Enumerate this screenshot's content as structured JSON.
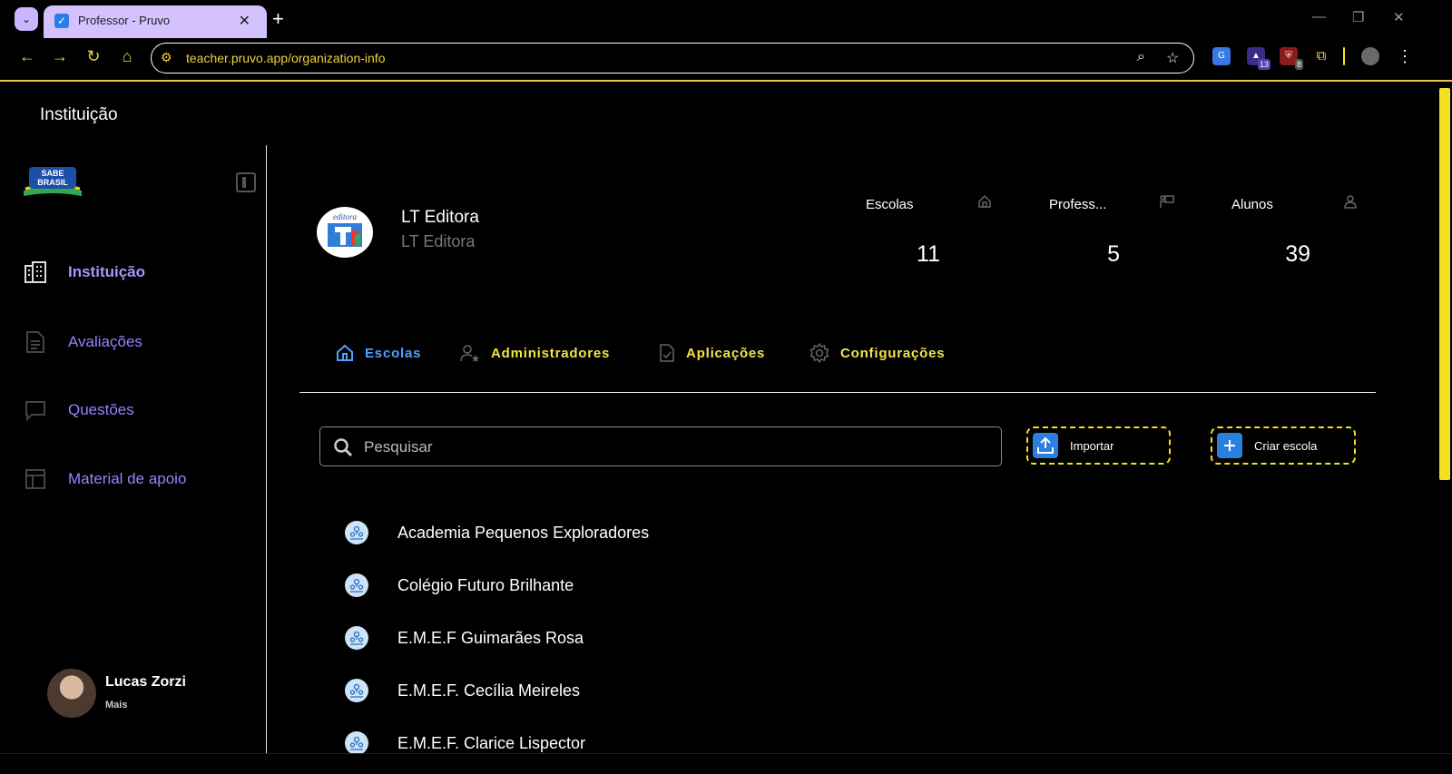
{
  "browser": {
    "tab_title": "Professor - Pruvo",
    "url": "teacher.pruvo.app/organization-info",
    "extensions": [
      {
        "name": "google-translate-icon",
        "badge": ""
      },
      {
        "name": "graduation-cap-extension-icon",
        "badge": "13"
      },
      {
        "name": "shield-extension-icon",
        "badge": "8"
      },
      {
        "name": "puzzle-icon",
        "badge": ""
      }
    ]
  },
  "page": {
    "header": "Instituição"
  },
  "sidebar": {
    "logo_text": "SABE BRASIL",
    "items": [
      {
        "label": "Instituição",
        "icon": "building-icon",
        "active": true
      },
      {
        "label": "Avaliações",
        "icon": "document-icon",
        "active": false
      },
      {
        "label": "Questões",
        "icon": "chat-icon",
        "active": false
      },
      {
        "label": "Material de apoio",
        "icon": "layout-icon",
        "active": false
      }
    ],
    "user": {
      "name": "Lucas Zorzi",
      "sub": "Mais"
    }
  },
  "org": {
    "name": "LT Editora",
    "subtitle": "LT Editora",
    "logo_text": "editora",
    "stats": [
      {
        "label": "Escolas",
        "value": "11",
        "icon": "home-icon"
      },
      {
        "label": "Profess...",
        "value": "5",
        "icon": "teacher-icon"
      },
      {
        "label": "Alunos",
        "value": "39",
        "icon": "person-icon"
      }
    ]
  },
  "tabs": [
    {
      "label": "Escolas",
      "icon": "home-icon",
      "active": true
    },
    {
      "label": "Administradores",
      "icon": "admin-user-icon",
      "active": false
    },
    {
      "label": "Aplicações",
      "icon": "checked-document-icon",
      "active": false
    },
    {
      "label": "Configurações",
      "icon": "gear-icon",
      "active": false
    }
  ],
  "search": {
    "placeholder": "Pesquisar"
  },
  "buttons": {
    "import": "Importar",
    "create": "Criar escola"
  },
  "schools": [
    "Academia Pequenos Exploradores",
    "Colégio Futuro Brilhante",
    "E.M.E.F Guimarães Rosa",
    "E.M.E.F. Cecília Meireles",
    "E.M.E.F. Clarice Lispector"
  ],
  "colors": {
    "accent_yellow": "#f3e01e",
    "nav_purple": "#8f86ff",
    "active_blue": "#4aa3ff",
    "button_blue": "#2a80df"
  }
}
